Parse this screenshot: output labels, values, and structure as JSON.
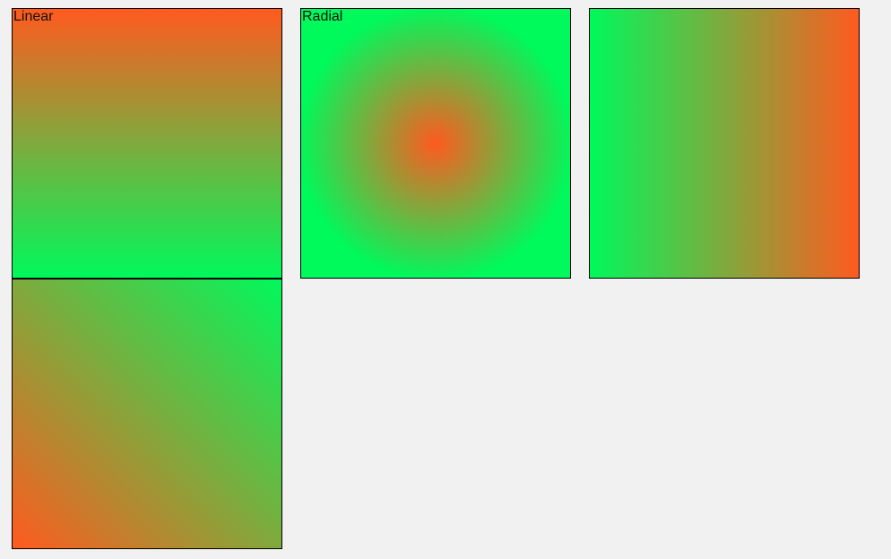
{
  "colors": {
    "background": "#f1f1f1",
    "orange": "#ff5a1f",
    "green": "#00f95b",
    "border": "#000000"
  },
  "panels": {
    "linear": {
      "label": "Linear"
    },
    "radial": {
      "label": "Radial"
    },
    "horizontal": {
      "label": ""
    },
    "diagonal": {
      "label": ""
    }
  }
}
